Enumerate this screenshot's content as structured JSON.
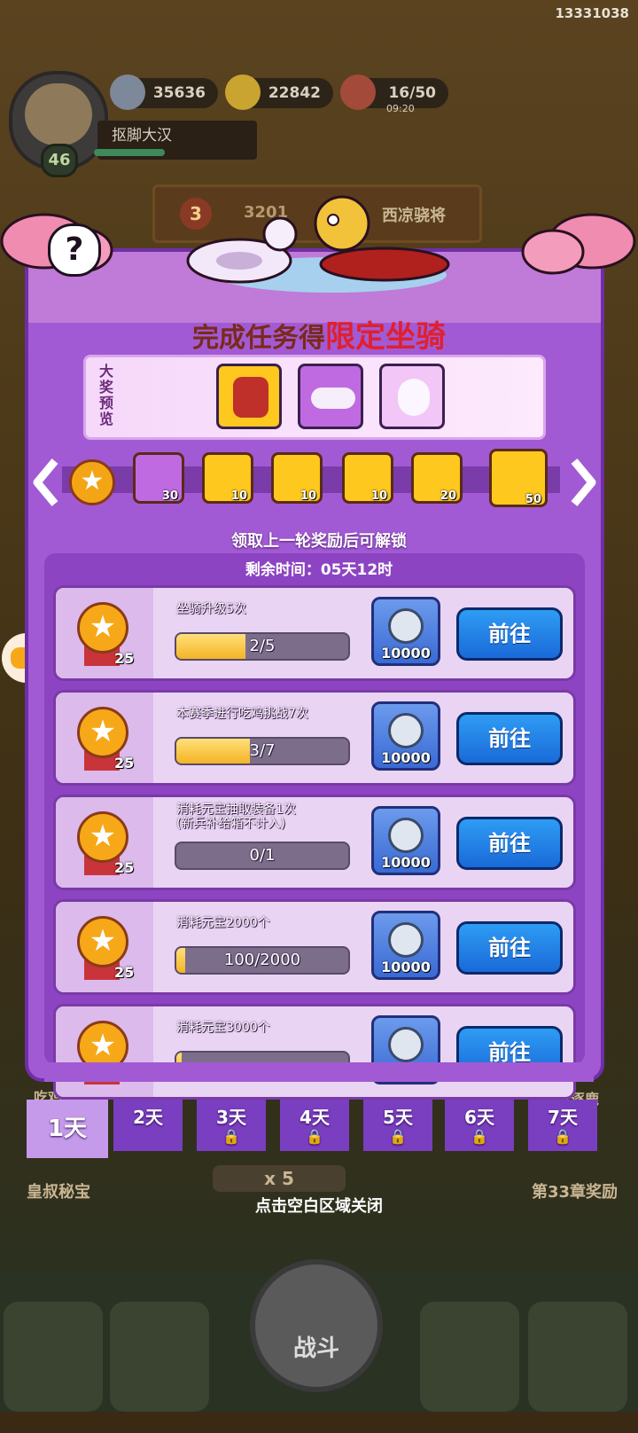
{
  "uid": "13331038",
  "player": {
    "name": "抠脚大汉",
    "level": "46"
  },
  "resources": [
    {
      "icon": "silver-coin-icon",
      "value": "35636"
    },
    {
      "icon": "gold-ingot-icon",
      "value": "22842"
    },
    {
      "icon": "meat-stamina-icon",
      "value": "16/50",
      "sub": "09:20"
    }
  ],
  "popup": {
    "title_prefix": "完成任务得",
    "title_highlight": "限定坐骑",
    "preview_label": "大奖预览",
    "track_chests": [
      "30",
      "10",
      "10",
      "10",
      "20",
      "50"
    ],
    "unlock_hint": "领取上一轮奖励后可解锁",
    "remaining": "剩余时间：05天12时",
    "tasks": [
      {
        "desc": "坐骑升级5次",
        "progress": "2/5",
        "ratio": 0.4,
        "medal": "25",
        "reward": "10000",
        "go": "前往"
      },
      {
        "desc": "本赛季进行吃鸡挑战7次",
        "progress": "3/7",
        "ratio": 0.43,
        "medal": "25",
        "reward": "10000",
        "go": "前往"
      },
      {
        "desc": "消耗元宝抽取装备1次\n(新兵补给箱不计入)",
        "progress": "0/1",
        "ratio": 0,
        "medal": "25",
        "reward": "10000",
        "go": "前往"
      },
      {
        "desc": "消耗元宝2000个",
        "progress": "100/2000",
        "ratio": 0.05,
        "medal": "25",
        "reward": "10000",
        "go": "前往"
      },
      {
        "desc": "消耗元宝3000个",
        "progress": "",
        "ratio": 0.03,
        "medal": "",
        "reward": "",
        "go": "前往"
      }
    ],
    "days": [
      "1天",
      "2天",
      "3天",
      "4天",
      "5天",
      "6天",
      "7天"
    ]
  },
  "background": {
    "stage_name": "西凉骁将",
    "stage_number": "3",
    "stage_score": "3201",
    "left_label": "皇叔秘宝",
    "right_label": "第33章奖励",
    "right_top_label": "群雄逐鹿",
    "left_top_label": "吃鸡",
    "stamina_cost": "x 5",
    "fight": "战斗"
  },
  "close_hint": "点击空白区域关闭",
  "colors": {
    "panel": "#a25ad4",
    "go_button": "#1a6ad8",
    "title_highlight": "#e0202e"
  }
}
